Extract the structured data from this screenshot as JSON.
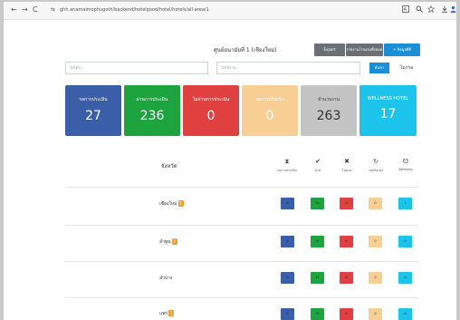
{
  "browser": {
    "url": "ghh.anamaimophugoth/backend/hotelgood/hotel/hotels/all-area/1",
    "back_icon": "←",
    "forward_icon": "→",
    "reload_icon": "C",
    "site_icon": "⇆",
    "right_icons": [
      "translate-icon",
      "zoom-icon",
      "star-icon",
      "download-icon",
      "profile-icon"
    ]
  },
  "header": {
    "title": "ศูนย์อนามัยที่ 1 (เชียงใหม่)",
    "export_label": "Export",
    "report_label": "รายงานโรงแรมทั้งหมด",
    "add_label": "+ ข้อมูลที่ดี"
  },
  "filters": {
    "province_placeholder": "ไม่ได้ระ",
    "district_placeholder": "ไม่ได้ระบุ",
    "search_label": "ค้นหา",
    "clear_label": "ไม่กรอ"
  },
  "cards": [
    {
      "label": "รอการประเมิน",
      "value": "27",
      "color": "#3a5fa8"
    },
    {
      "label": "ผ่านการประเมิน",
      "value": "236",
      "color": "#1ea43f"
    },
    {
      "label": "ไม่ผ่านการประเมิน",
      "value": "0",
      "color": "#e04040"
    },
    {
      "label": "รอการปรับปรุง",
      "value": "0",
      "color": "#f7cf95"
    },
    {
      "label": "จำนวนงาน",
      "value": "263",
      "color": "#c4c4c4"
    },
    {
      "label": "WELLNESS HOTEL",
      "value": "17",
      "color": "#1cc4ec"
    }
  ],
  "table": {
    "province_header": "จังหวัด",
    "columns": [
      {
        "icon": "⧗",
        "label": "รอการประเมิน"
      },
      {
        "icon": "✔",
        "label": "ผ่าน"
      },
      {
        "icon": "✖",
        "label": "ไม่ผ่าน"
      },
      {
        "icon": "↻",
        "label": "รอปรับปรุง"
      },
      {
        "icon": "☋",
        "label": "Wellness"
      }
    ],
    "rows": [
      {
        "name": "เชียงใหม่",
        "badge": "1",
        "values": [
          "5",
          "34",
          "0",
          "0",
          "1"
        ]
      },
      {
        "name": "ลำพูน",
        "badge": "7",
        "values": [
          "2",
          "8",
          "0",
          "0",
          "0"
        ]
      },
      {
        "name": "ลำปาง",
        "badge": "",
        "values": [
          "0",
          "11",
          "0",
          "0",
          "0"
        ]
      },
      {
        "name": "แพร่",
        "badge": "1",
        "values": [
          "2",
          "9",
          "0",
          "0",
          "0"
        ]
      }
    ]
  }
}
